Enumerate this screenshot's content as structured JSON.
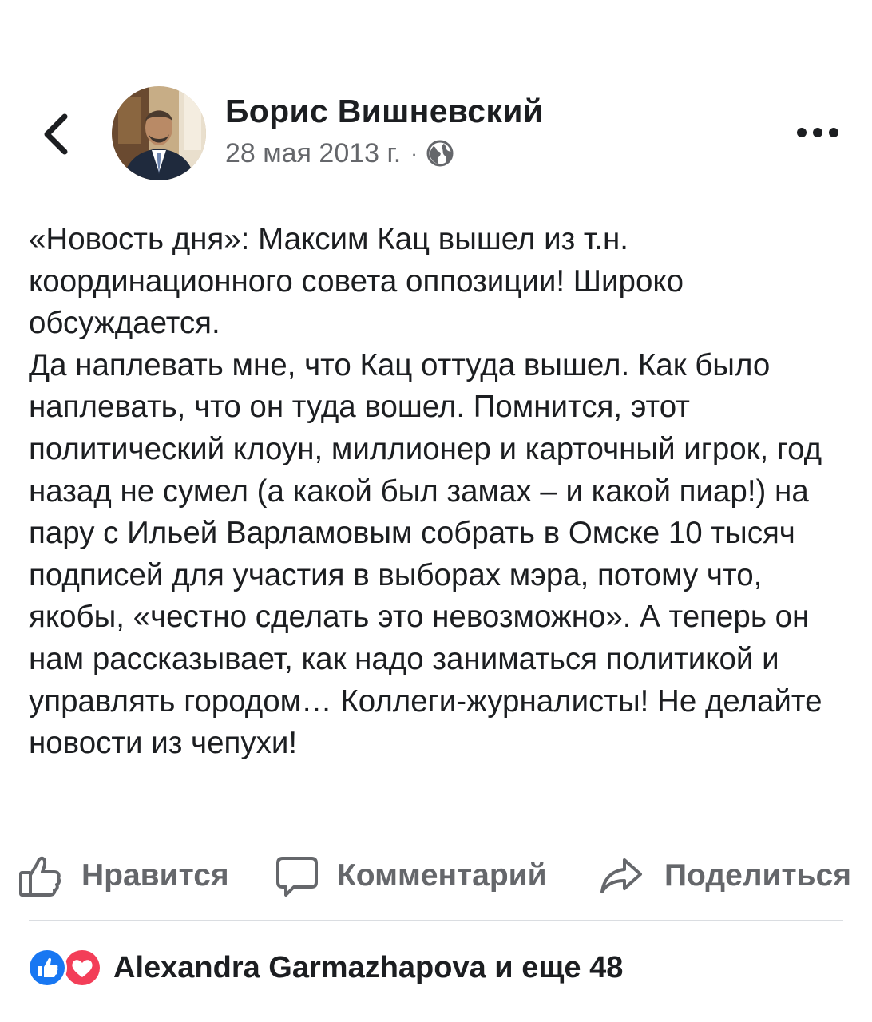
{
  "header": {
    "back_icon": "chevron-left-icon",
    "author_name": "Борис Вишневский",
    "date": "28 мая 2013 г.",
    "separator": "·",
    "privacy_icon": "globe-icon",
    "more_icon": "more-horizontal-icon"
  },
  "post": {
    "paragraphs": [
      "«Новость дня»: Максим Кац вышел из т.н. координационного совета оппозиции! Широко обсуждается.",
      "Да наплевать мне, что Кац оттуда вышел. Как было наплевать, что он туда вошел. Помнится, этот политический клоун, миллионер и карточный игрок, год назад не сумел (а какой был замах – и какой пиар!) на пару с Ильей Варламовым собрать в Омске 10 тысяч подписей для участия в выборах мэра, потому что, якобы, «честно  сделать это невозможно». А теперь он нам рассказывает, как надо заниматься политикой и управлять городом… Коллеги-журналисты! Не делайте новости из чепухи!"
    ]
  },
  "actions": {
    "like_label": "Нравится",
    "comment_label": "Комментарий",
    "share_label": "Поделиться"
  },
  "reactions": {
    "summary": "Alexandra Garmazhapova и еще 48",
    "icons": [
      "like-reaction-icon",
      "love-reaction-icon"
    ]
  },
  "colors": {
    "text": "#1c1e21",
    "secondary_text": "#65676b",
    "like_blue": "#1877f2",
    "love_red": "#f33e58",
    "divider": "#dadde1"
  }
}
